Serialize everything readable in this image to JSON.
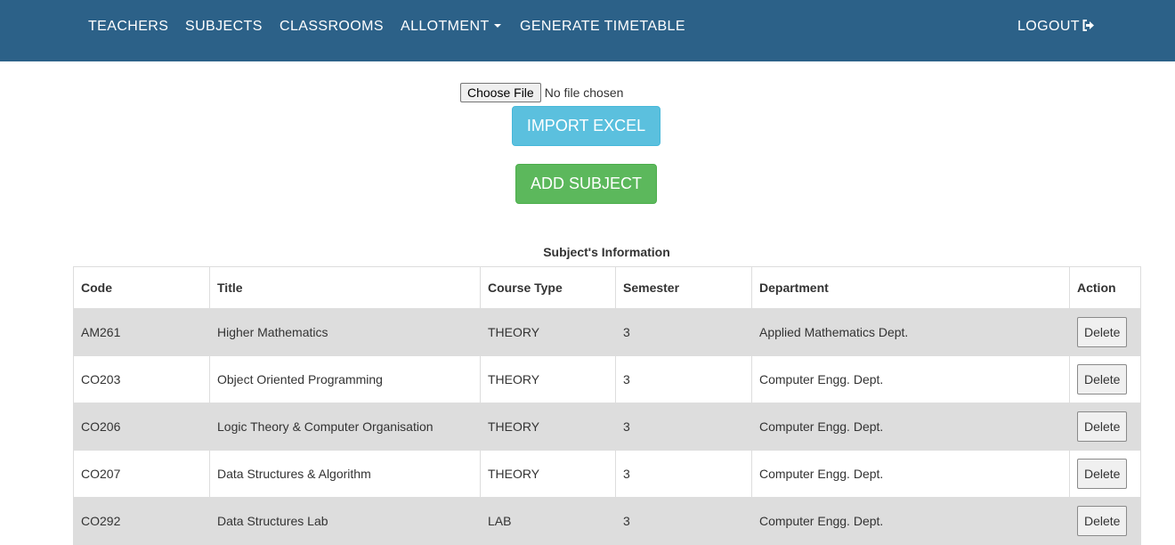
{
  "nav": {
    "teachers": "TEACHERS",
    "subjects": "SUBJECTS",
    "classrooms": "CLASSROOMS",
    "allotment": "ALLOTMENT",
    "generate": "GENERATE TIMETABLE",
    "logout": "LOGOUT",
    "logout_icon": "sign-out-icon",
    "allotment_icon": "caret-down-icon"
  },
  "upload": {
    "choose_label": "Choose File",
    "status": "No file chosen",
    "import_label": "IMPORT EXCEL"
  },
  "add_label": "ADD SUBJECT",
  "table": {
    "caption": "Subject's Information",
    "headers": [
      "Code",
      "Title",
      "Course Type",
      "Semester",
      "Department",
      "Action"
    ],
    "rows": [
      {
        "code": "AM261",
        "title": "Higher Mathematics",
        "type": "THEORY",
        "semester": "3",
        "department": "Applied Mathematics Dept.",
        "action": "Delete"
      },
      {
        "code": "CO203",
        "title": "Object Oriented Programming",
        "type": "THEORY",
        "semester": "3",
        "department": "Computer Engg. Dept.",
        "action": "Delete"
      },
      {
        "code": "CO206",
        "title": "Logic Theory & Computer Organisation",
        "type": "THEORY",
        "semester": "3",
        "department": "Computer Engg. Dept.",
        "action": "Delete"
      },
      {
        "code": "CO207",
        "title": "Data Structures & Algorithm",
        "type": "THEORY",
        "semester": "3",
        "department": "Computer Engg. Dept.",
        "action": "Delete"
      },
      {
        "code": "CO292",
        "title": "Data Structures Lab",
        "type": "LAB",
        "semester": "3",
        "department": "Computer Engg. Dept.",
        "action": "Delete"
      }
    ]
  },
  "colors": {
    "navbar": "#2c6188",
    "import": "#5bc0de",
    "add": "#5cb85c",
    "stripe": "#dddddd"
  }
}
